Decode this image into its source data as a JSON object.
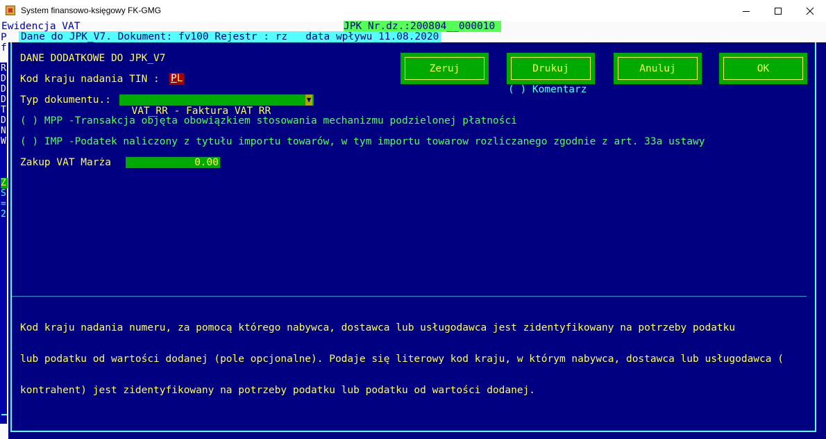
{
  "window": {
    "title": "System finansowo-księgowy FK-GMG",
    "minimize_glyph": "—",
    "maximize_glyph": "☐",
    "close_glyph": "✕"
  },
  "background": {
    "module_title": "Ewidencja VAT",
    "jpk_number": "JPK Nr.dz.:200804__000010",
    "side_p": "P",
    "side_f": "f",
    "side_letters": [
      "R",
      "D",
      "D",
      "D",
      "T",
      "D",
      "N",
      "W"
    ],
    "side_z": "Z",
    "side_s": "S",
    "side_eq": "=",
    "side_2": "2"
  },
  "dialog": {
    "header": "Dane do JPK_V7. Dokument: fv100 Rejestr : rz   data wpływu 11.08.2020",
    "section_title": "DANE DODATKOWE DO JPK_V7",
    "tin_label": "Kod kraju nadania TIN : ",
    "tin_value_first": "P",
    "tin_value_rest": "L",
    "typ_label": "Typ dokumentu.: ",
    "typ_value": "VAT_RR - Faktura VAT RR",
    "typ_arrow": "▼",
    "mpp_option": "( ) MPP -Transakcja objęta obowiązkiem stosowania mechanizmu podzielonej płatności",
    "imp_option": "( ) IMP -Podatek naliczony z tytułu importu towarów, w tym importu towarow rozliczanego zgodnie z art. 33a ustawy",
    "marza_label": "Zakup VAT Marża",
    "marza_value": "0.00",
    "komentarz_option": "( ) Komentarz",
    "buttons": {
      "zeruj": "Zeruj",
      "drukuj": "Drukuj",
      "anuluj": "Anuluj",
      "ok": "OK"
    },
    "help_lines": [
      "Kod kraju nadania numeru, za pomocą którego nabywca, dostawca lub usługodawca jest zidentyfikowany na potrzeby podatku",
      "lub podatku od wartości dodanej (pole opcjonalne). Podaje się literowy kod kraju, w którym nabywca, dostawca lub usługodawca (",
      "kontrahent) jest zidentyfikowany na potrzeby podatku lub podatku od wartości dodanej."
    ]
  },
  "colors": {
    "background": "#000080",
    "accent_yellow": "#ffff55",
    "accent_cyan": "#55ffff",
    "field_green": "#00aa00",
    "tin_red": "#aa0000"
  }
}
